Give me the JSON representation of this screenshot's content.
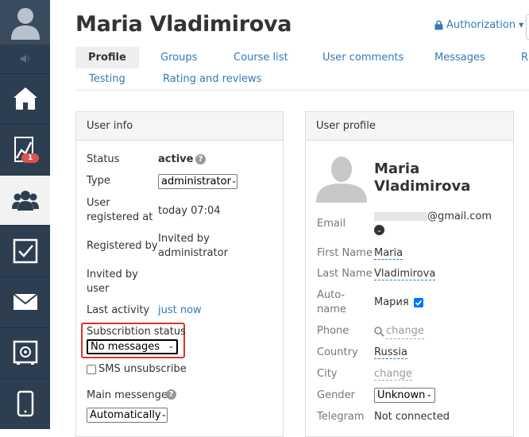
{
  "sidebar": {
    "items": [
      {
        "name": "home",
        "label": "Home"
      },
      {
        "name": "stats",
        "label": "Statistics",
        "badge": "1"
      },
      {
        "name": "users",
        "label": "Users",
        "active": true
      },
      {
        "name": "tasks",
        "label": "Tasks"
      },
      {
        "name": "mail",
        "label": "Mail"
      },
      {
        "name": "safe",
        "label": "Safe"
      },
      {
        "name": "mobile",
        "label": "Mobile"
      }
    ]
  },
  "header": {
    "title": "Maria Vladimirova",
    "authorization": "Authorization"
  },
  "tabs": [
    {
      "label": "Profile",
      "active": true
    },
    {
      "label": "Groups"
    },
    {
      "label": "Course list"
    },
    {
      "label": "User comments"
    },
    {
      "label": "Messages"
    },
    {
      "label": "Ri"
    },
    {
      "label": "Testing"
    },
    {
      "label": "Rating and reviews"
    }
  ],
  "user_info": {
    "title": "User info",
    "status_label": "Status",
    "status_value": "active",
    "type_label": "Type",
    "type_value": "administrator",
    "registered_at_label_1": "User",
    "registered_at_label_2": "registered at",
    "registered_at_value": "today 07:04",
    "registered_by_label": "Registered by",
    "registered_by_value_1": "Invited by",
    "registered_by_value_2": "administrator",
    "invited_by_label_1": "Invited by",
    "invited_by_label_2": "user",
    "last_activity_label": "Last activity",
    "last_activity_value": "just now",
    "subscription_label": "Subscribtion status",
    "subscription_value": "No messages",
    "sms_unsubscribe": "SMS unsubscribe",
    "main_messenger_label": "Main messenger",
    "main_messenger_value": "Automatically"
  },
  "user_profile": {
    "title": "User profile",
    "name_first": "Maria",
    "name_last": "Vladimirova",
    "email_label": "Email",
    "email_value": "@gmail.com",
    "first_name_label": "First Name",
    "first_name_value": "Maria",
    "last_name_label": "Last Name",
    "last_name_value": "Vladimirova",
    "auto_name_label_1": "Auto-",
    "auto_name_label_2": "name",
    "auto_name_value": "Мария",
    "phone_label": "Phone",
    "phone_value": "change",
    "country_label": "Country",
    "country_value": "Russia",
    "city_label": "City",
    "city_value": "change",
    "gender_label": "Gender",
    "gender_value": "Unknown",
    "telegram_label": "Telegram",
    "telegram_value": "Not connected"
  },
  "colors": {
    "sidebar": "#2d3e50",
    "link": "#337ab7",
    "badge": "#d9534f",
    "highlight": "#d9372b"
  }
}
